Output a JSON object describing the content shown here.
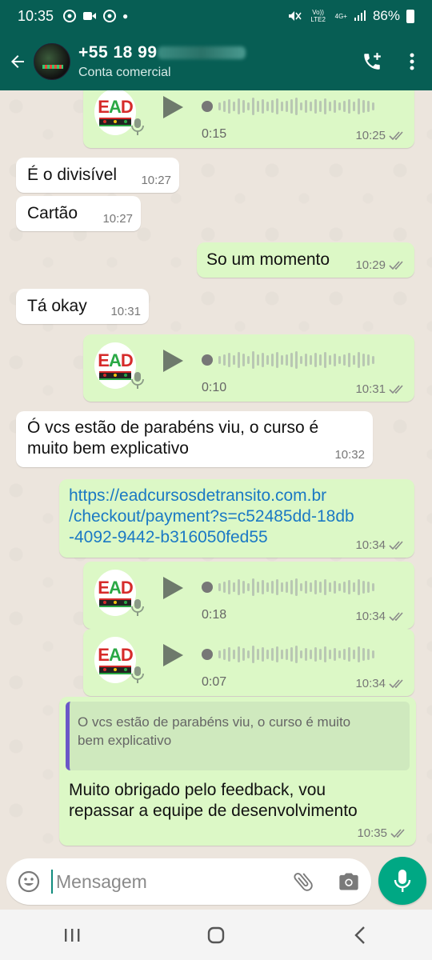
{
  "status": {
    "time": "10:35",
    "network": "4G+",
    "volte": "Vo)) LTE2",
    "battery": "86%"
  },
  "header": {
    "contact_prefix": "+55 18 99",
    "subtitle": "Conta comercial"
  },
  "voice_logo": {
    "e": "E",
    "a": "A",
    "d": "D"
  },
  "messages": {
    "v1": {
      "duration": "0:15",
      "time": "10:25"
    },
    "m2": {
      "text": "É o divisível",
      "time": "10:27"
    },
    "m3": {
      "text": "Cartão",
      "time": "10:27"
    },
    "m4": {
      "text": "So um momento",
      "time": "10:29"
    },
    "m5": {
      "text": "Tá okay",
      "time": "10:31"
    },
    "v2": {
      "duration": "0:10",
      "time": "10:31"
    },
    "m7": {
      "line1": "Ó vcs estão de parabéns viu, o curso é",
      "line2": "muito bem explicativo",
      "time": "10:32"
    },
    "m8": {
      "line1": "https://eadcursosdetransito.com.br",
      "line2": "/checkout/payment?s=c52485dd-18db",
      "line3": "-4092-9442-b316050fed55",
      "time": "10:34"
    },
    "v3": {
      "duration": "0:18",
      "time": "10:34"
    },
    "v4": {
      "duration": "0:07",
      "time": "10:34"
    },
    "m11": {
      "quote1": "O vcs estão de parabéns viu, o curso é muito",
      "quote2": "bem explicativo",
      "line1": "Muito obrigado pelo feedback, vou",
      "line2": "repassar a equipe de desenvolvimento",
      "time": "10:35"
    }
  },
  "input": {
    "placeholder": "Mensagem"
  },
  "colors": {
    "header": "#075e54",
    "outgoing": "#dcf8c6",
    "incoming": "#ffffff",
    "accent": "#00a884",
    "link": "#1b79c4"
  },
  "icons": [
    "back-arrow-icon",
    "add-call-icon",
    "more-vert-icon",
    "play-icon",
    "mic-icon",
    "emoji-icon",
    "attach-icon",
    "camera-icon",
    "double-check-icon"
  ]
}
